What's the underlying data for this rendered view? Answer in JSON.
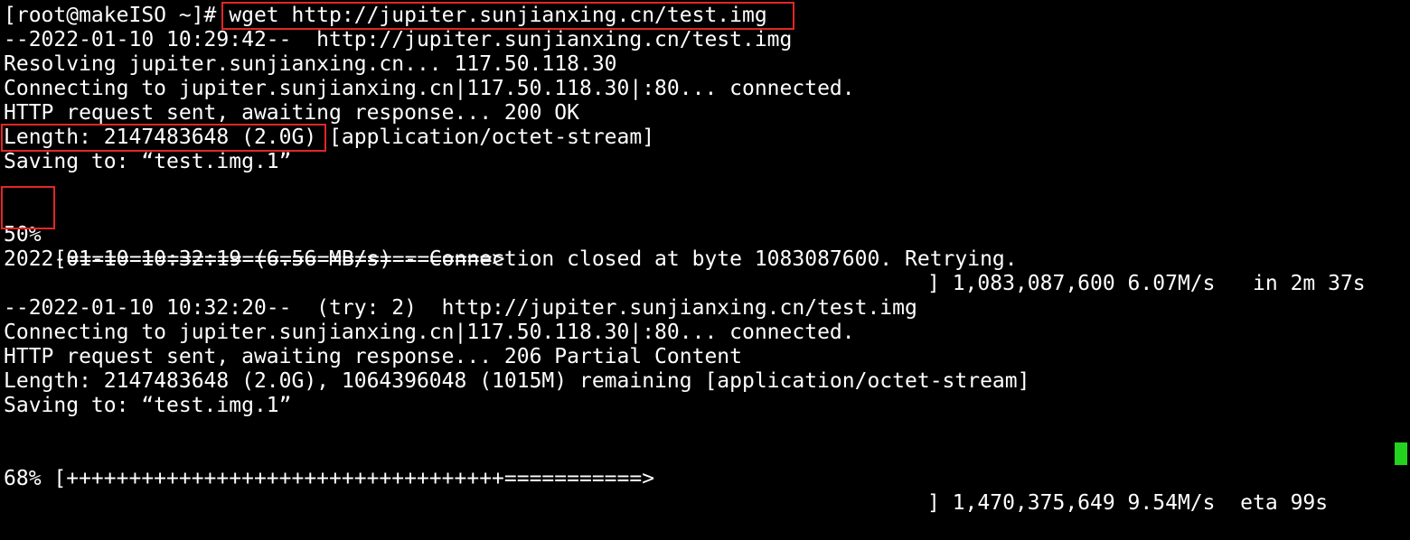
{
  "terminal": {
    "prompt": "[root@makeISO ~]# ",
    "command": "wget http://jupiter.sunjianxing.cn/test.img",
    "output": [
      "--2022-01-10 10:29:42--  http://jupiter.sunjianxing.cn/test.img",
      "Resolving jupiter.sunjianxing.cn... 117.50.118.30",
      "Connecting to jupiter.sunjianxing.cn|117.50.118.30|:80... connected.",
      "HTTP request sent, awaiting response... 200 OK"
    ],
    "length_value": "Length: 2147483648 (2.0G)",
    "length_type": " [application/octet-stream]",
    "saving_1": "Saving to: “test.img.1”",
    "progress_1": {
      "percent": "50%",
      "bar": " [==================================>",
      "stats": "] 1,083,087,600 6.07M/s   in 2m 37s",
      "fraction": 0.5
    },
    "closed_line": "2022-01-10 10:32:19 (6.56 MB/s) - Connection closed at byte 1083087600. Retrying.",
    "retry_output": [
      "--2022-01-10 10:32:20--  (try: 2)  http://jupiter.sunjianxing.cn/test.img",
      "Connecting to jupiter.sunjianxing.cn|117.50.118.30|:80... connected.",
      "HTTP request sent, awaiting response... 206 Partial Content",
      "Length: 2147483648 (2.0G), 1064396048 (1015M) remaining [application/octet-stream]",
      "Saving to: “test.img.1”"
    ],
    "progress_2": {
      "text": "68% [+++++++++++++++++++++++++++++++++++===========>",
      "stats": "] 1,470,375,649 9.54M/s  eta 99s",
      "fraction": 0.68
    }
  },
  "colors": {
    "background": "#000000",
    "foreground": "#ffffff",
    "highlight_border": "#e32626",
    "cursor": "#23d31f"
  }
}
